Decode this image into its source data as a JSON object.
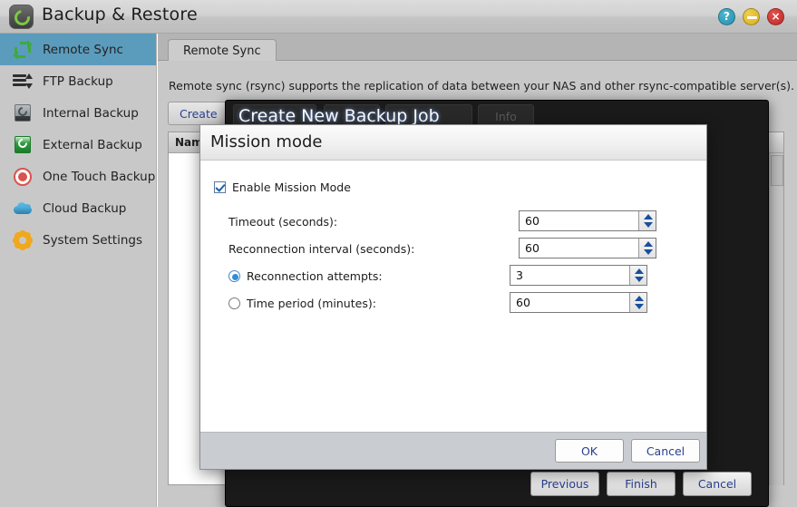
{
  "window": {
    "title": "Backup & Restore",
    "app_icon": "backup-restore-icon",
    "controls": {
      "help": "?",
      "minimize": "",
      "close": "×"
    }
  },
  "sidebar": {
    "items": [
      {
        "label": "Remote Sync",
        "icon": "sync-arrows-icon",
        "selected": true
      },
      {
        "label": "FTP Backup",
        "icon": "ftp-transfer-icon",
        "selected": false
      },
      {
        "label": "Internal Backup",
        "icon": "internal-disk-icon",
        "selected": false
      },
      {
        "label": "External Backup",
        "icon": "external-disk-icon",
        "selected": false
      },
      {
        "label": "One Touch Backup",
        "icon": "record-button-icon",
        "selected": false
      },
      {
        "label": "Cloud Backup",
        "icon": "cloud-icon",
        "selected": false
      },
      {
        "label": "System Settings",
        "icon": "gear-icon",
        "selected": false
      }
    ]
  },
  "content": {
    "tab_label": "Remote Sync",
    "description": "Remote sync (rsync) supports the replication of data between your NAS and other rsync-compatible server(s).",
    "toolbar": {
      "create": "Create",
      "info": "Info"
    },
    "table": {
      "columns": [
        "Name"
      ]
    }
  },
  "wizard": {
    "title": "Create New Backup Job",
    "buttons": {
      "previous": "Previous",
      "finish": "Finish",
      "cancel": "Cancel"
    }
  },
  "mission_dialog": {
    "title": "Mission mode",
    "enable": {
      "label": "Enable Mission Mode",
      "checked": true
    },
    "fields": [
      {
        "label": "Timeout (seconds):",
        "value": "60",
        "control": "checkbox-none"
      },
      {
        "label": "Reconnection interval (seconds):",
        "value": "60",
        "control": "checkbox-none"
      },
      {
        "label": "Reconnection attempts:",
        "value": "3",
        "control": "radio",
        "selected": true
      },
      {
        "label": "Time period (minutes):",
        "value": "60",
        "control": "radio",
        "selected": false
      }
    ],
    "buttons": {
      "ok": "OK",
      "cancel": "Cancel"
    }
  },
  "colors": {
    "sidebar_selected": "#5b9cbd",
    "row_selected": "#17ace3",
    "button_text": "#2a3f8f",
    "wizard_background": "#1a1a1a"
  }
}
